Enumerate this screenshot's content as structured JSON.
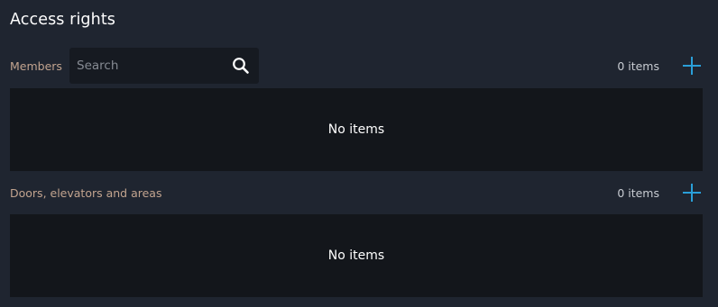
{
  "panel": {
    "title": "Access rights"
  },
  "members": {
    "label": "Members",
    "search_placeholder": "Search",
    "search_value": "",
    "count_text": "0 items",
    "empty_text": "No items",
    "add_icon": "plus-icon"
  },
  "doors": {
    "label": "Doors, elevators and areas",
    "count_text": "0 items",
    "empty_text": "No items",
    "add_icon": "plus-icon"
  },
  "colors": {
    "background": "#1f2530",
    "list_background": "#13161b",
    "search_background": "#161a21",
    "accent": "#2a9fd8",
    "label": "#c2a48f"
  }
}
